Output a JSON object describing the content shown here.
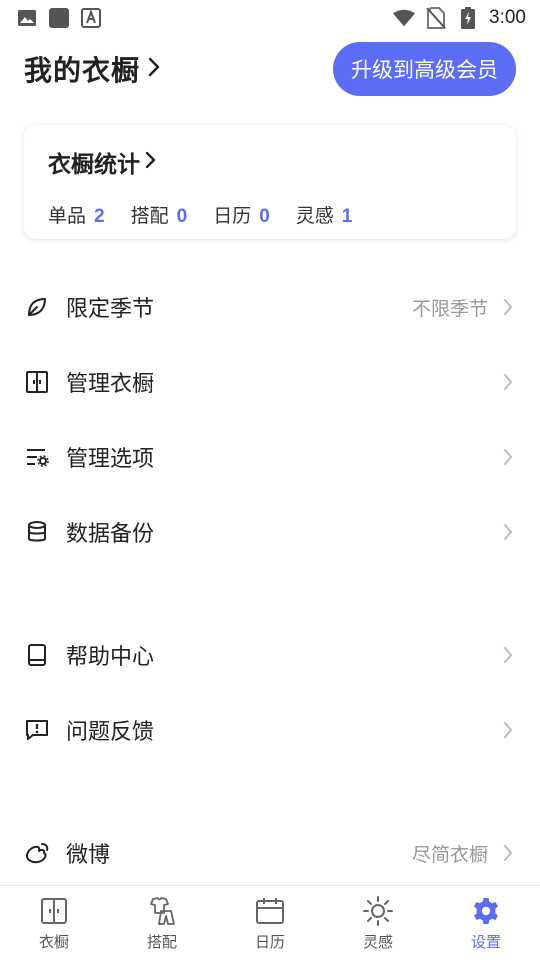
{
  "status_bar": {
    "time": "3:00",
    "icons": [
      "image-icon",
      "square-icon",
      "a-icon",
      "wifi-icon",
      "no-sim-icon",
      "battery-charging-icon"
    ]
  },
  "header": {
    "title": "我的衣橱",
    "upgrade_label": "升级到高级会员"
  },
  "stats_card": {
    "title": "衣橱统计",
    "stats": [
      {
        "label": "单品",
        "value": "2"
      },
      {
        "label": "搭配",
        "value": "0"
      },
      {
        "label": "日历",
        "value": "0"
      },
      {
        "label": "灵感",
        "value": "1"
      }
    ]
  },
  "menu": {
    "season": {
      "label": "限定季节",
      "value": "不限季节",
      "icon": "leaf-icon"
    },
    "manage_wardrobe": {
      "label": "管理衣橱",
      "icon": "wardrobe-icon"
    },
    "manage_options": {
      "label": "管理选项",
      "icon": "list-settings-icon"
    },
    "backup": {
      "label": "数据备份",
      "icon": "database-icon"
    },
    "help": {
      "label": "帮助中心",
      "icon": "book-icon"
    },
    "feedback": {
      "label": "问题反馈",
      "icon": "feedback-icon"
    },
    "weibo": {
      "label": "微博",
      "value": "尽简衣橱",
      "icon": "weibo-icon"
    }
  },
  "bottom_nav": {
    "items": [
      {
        "label": "衣橱",
        "icon": "wardrobe-icon"
      },
      {
        "label": "搭配",
        "icon": "outfit-icon"
      },
      {
        "label": "日历",
        "icon": "calendar-icon"
      },
      {
        "label": "灵感",
        "icon": "sun-icon"
      },
      {
        "label": "设置",
        "icon": "settings-gear-icon"
      }
    ],
    "active_index": 4
  },
  "colors": {
    "accent": "#5b6cf5",
    "text": "#222222",
    "muted": "#999999"
  }
}
